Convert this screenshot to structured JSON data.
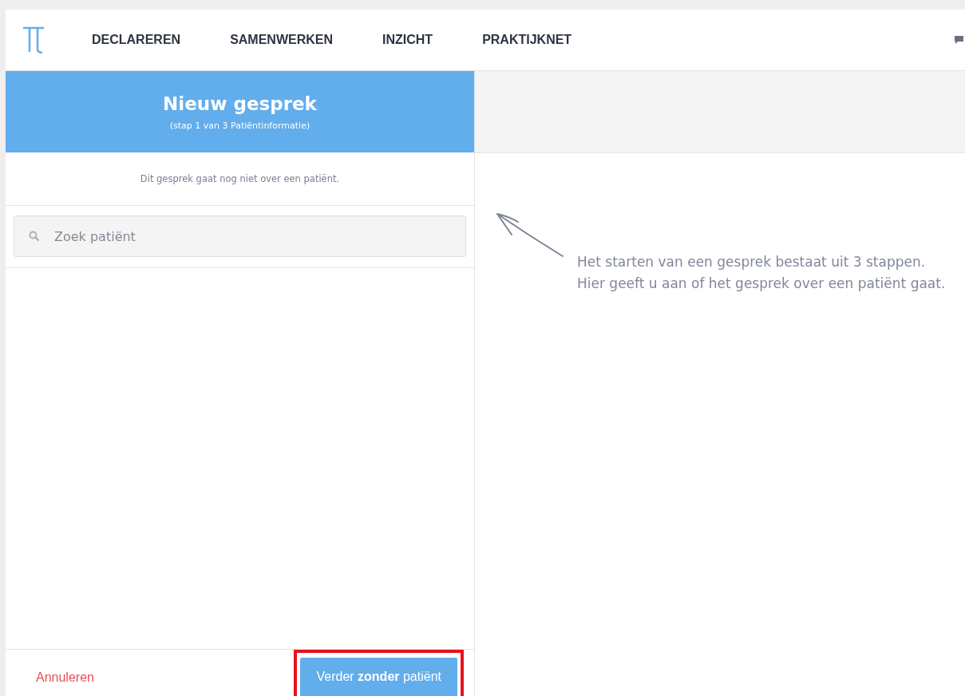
{
  "nav": {
    "items": [
      {
        "label": "DECLAREREN"
      },
      {
        "label": "SAMENWERKEN"
      },
      {
        "label": "INZICHT"
      },
      {
        "label": "PRAKTIJKNET"
      }
    ]
  },
  "panel": {
    "title": "Nieuw gesprek",
    "subtitle": "(stap 1 van 3 Patiëntinformatie)",
    "info": "Dit gesprek gaat nog niet over een patiënt.",
    "search": {
      "placeholder": "Zoek patiënt"
    }
  },
  "footer": {
    "cancel": "Annuleren",
    "continue": {
      "label": "Verder **zonder** patiënt",
      "highlighted": true
    }
  },
  "hint": {
    "lines": [
      "Het starten van een gesprek bestaat uit 3 stappen.",
      "Hier geeft u aan of het gesprek over een patiënt gaat."
    ]
  }
}
